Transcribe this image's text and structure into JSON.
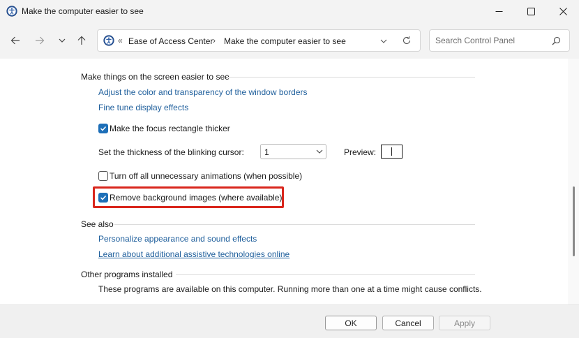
{
  "window": {
    "title": "Make the computer easier to see",
    "icon": "ease-of-access-icon"
  },
  "address": {
    "prefix": "«",
    "crumb1": "Ease of Access Center",
    "arrow": "›",
    "crumb2": "Make the computer easier to see"
  },
  "search": {
    "placeholder": "Search Control Panel"
  },
  "sections": {
    "screen": {
      "heading": "Make things on the screen easier to see",
      "link_colors": "Adjust the color and transparency of the window borders",
      "link_display": "Fine tune display effects",
      "focus_label": "Make the focus rectangle thicker",
      "focus_checked": true,
      "thickness_label": "Set the thickness of the blinking cursor:",
      "thickness_value": "1",
      "preview_label": "Preview:",
      "animations_label": "Turn off all unnecessary animations (when possible)",
      "animations_checked": false,
      "background_label": "Remove background images (where available)",
      "background_checked": true
    },
    "see_also": {
      "heading": "See also",
      "link_personalize": "Personalize appearance and sound effects",
      "link_assistive": "Learn about additional assistive technologies online"
    },
    "other": {
      "heading": "Other programs installed",
      "text": "These programs are available on this computer. Running more than one at a time might cause conflicts."
    }
  },
  "footer": {
    "ok": "OK",
    "cancel": "Cancel",
    "apply": "Apply"
  },
  "colors": {
    "link": "#1f5f9c",
    "checkbox": "#1d6fb8",
    "highlight": "#d9261c"
  }
}
